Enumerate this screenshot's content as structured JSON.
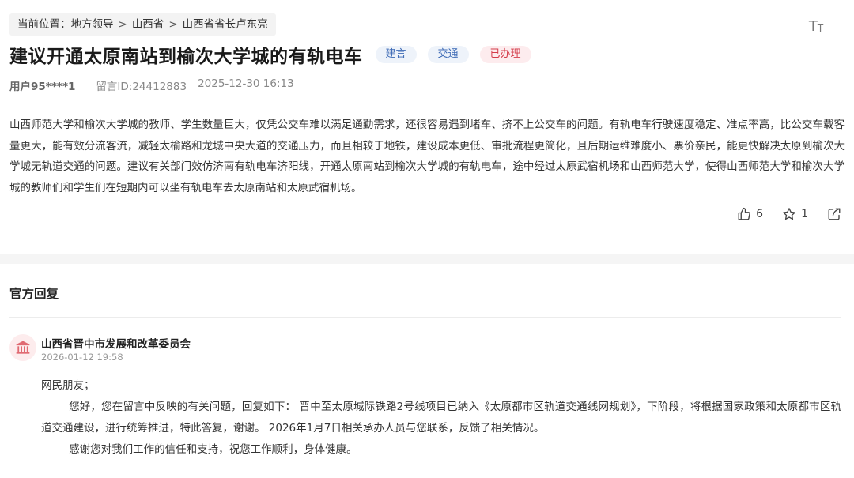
{
  "breadcrumb": {
    "prefix": "当前位置：",
    "items": [
      "地方领导",
      "山西省",
      "山西省省长卢东亮"
    ],
    "separator": ">"
  },
  "font_size_icon": "text-size-icon",
  "message": {
    "title": "建议开通太原南站到榆次大学城的有轨电车",
    "tags": [
      {
        "label": "建言",
        "color": "#3d6ab5"
      },
      {
        "label": "交通",
        "color": "#3d6ab5"
      },
      {
        "label": "已办理",
        "color": "#d43c4a"
      }
    ],
    "user": "用户95****1",
    "message_id": "留言ID:24412883",
    "datetime": "2025-12-30 16:13",
    "content": "山西师范大学和榆次大学城的教师、学生数量巨大，仅凭公交车难以满足通勤需求，还很容易遇到堵车、挤不上公交车的问题。有轨电车行驶速度稳定、准点率高，比公交车载客量更大，能有效分流客流，减轻太榆路和龙城中央大道的交通压力，而且相较于地铁，建设成本更低、审批流程更简化，且后期运维难度小、票价亲民，能更快解决太原到榆次大学城无轨道交通的问题。建议有关部门效仿济南有轨电车济阳线，开通太原南站到榆次大学城的有轨电车，途中经过太原武宿机场和山西师范大学，使得山西师范大学和榆次大学城的教师们和学生们在短期内可以坐有轨电车去太原南站和太原武宿机场。",
    "likes": "6",
    "favorites": "1"
  },
  "reply": {
    "heading": "官方回复",
    "department": "山西省晋中市发展和改革委员会",
    "datetime": "2026-01-12 19:58",
    "greeting": "网民朋友；",
    "paragraph1": "您好，您在留言中反映的有关问题，回复如下： 晋中至太原城际铁路2号线项目已纳入《太原都市区轨道交通线网规划》，下阶段，将根据国家政策和太原都市区轨道交通建设，进行统筹推进，特此答复，谢谢。 2026年1月7日相关承办人员与您联系，反馈了相关情况。",
    "paragraph2": "感谢您对我们工作的信任和支持，祝您工作顺利，身体健康。"
  },
  "colors": {
    "accent_red": "#d43c4a",
    "tag_blue": "#3d6ab5",
    "divider": "#f5f5f5"
  }
}
